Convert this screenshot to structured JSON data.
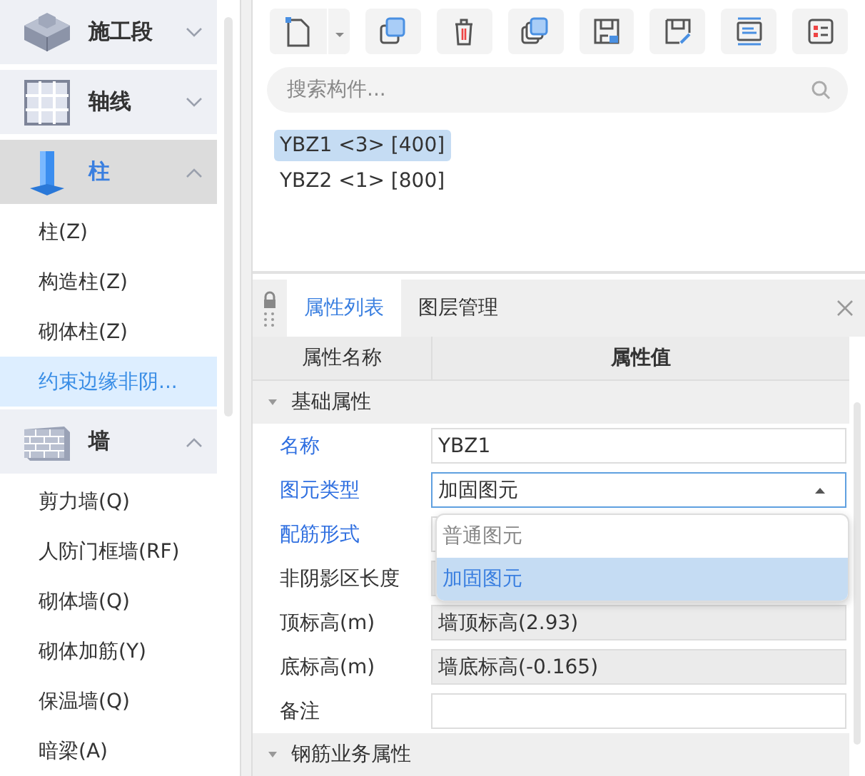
{
  "sidebar": {
    "groups": [
      {
        "label": "施工段",
        "expanded": false,
        "selected": false
      },
      {
        "label": "轴线",
        "expanded": false,
        "selected": false
      },
      {
        "label": "柱",
        "expanded": true,
        "selected": true,
        "items": [
          {
            "label": "柱(Z)",
            "selected": false
          },
          {
            "label": "构造柱(Z)",
            "selected": false
          },
          {
            "label": "砌体柱(Z)",
            "selected": false
          },
          {
            "label": "约束边缘非阴...",
            "selected": true
          }
        ]
      },
      {
        "label": "墙",
        "expanded": true,
        "selected": false,
        "items": [
          {
            "label": "剪力墙(Q)",
            "selected": false
          },
          {
            "label": "人防门框墙(RF)",
            "selected": false
          },
          {
            "label": "砌体墙(Q)",
            "selected": false
          },
          {
            "label": "砌体加筋(Y)",
            "selected": false
          },
          {
            "label": "保温墙(Q)",
            "selected": false
          },
          {
            "label": "暗梁(A)",
            "selected": false
          }
        ]
      }
    ]
  },
  "search": {
    "placeholder": "搜索构件..."
  },
  "components": [
    {
      "label": "YBZ1 <3> [400]",
      "selected": true
    },
    {
      "label": "YBZ2 <1> [800]",
      "selected": false
    }
  ],
  "properties": {
    "tabs": [
      {
        "label": "属性列表",
        "selected": true
      },
      {
        "label": "图层管理",
        "selected": false
      }
    ],
    "columns": [
      "属性名称",
      "属性值"
    ],
    "sections": [
      {
        "title": "基础属性",
        "expanded": true,
        "rows": [
          {
            "name": "名称",
            "public": true,
            "kind": "text",
            "value": "YBZ1",
            "editable": true
          },
          {
            "name": "图元类型",
            "public": true,
            "kind": "dropdown",
            "value": "加固图元",
            "editable": true,
            "open": true,
            "options": [
              {
                "label": "普通图元",
                "selected": false
              },
              {
                "label": "加固图元",
                "selected": true
              }
            ]
          },
          {
            "name": "配筋形式",
            "public": true,
            "kind": "text",
            "editable": true
          },
          {
            "name": "非阴影区长度",
            "public": false,
            "kind": "text",
            "editable": false
          },
          {
            "name": "顶标高(m)",
            "public": false,
            "kind": "text",
            "value": "墙顶标高(2.93)",
            "editable": false
          },
          {
            "name": "底标高(m)",
            "public": false,
            "kind": "text",
            "value": "墙底标高(-0.165)",
            "editable": false
          },
          {
            "name": "备注",
            "public": false,
            "kind": "text",
            "editable": true
          }
        ]
      },
      {
        "title": "钢筋业务属性",
        "expanded": true
      }
    ]
  }
}
